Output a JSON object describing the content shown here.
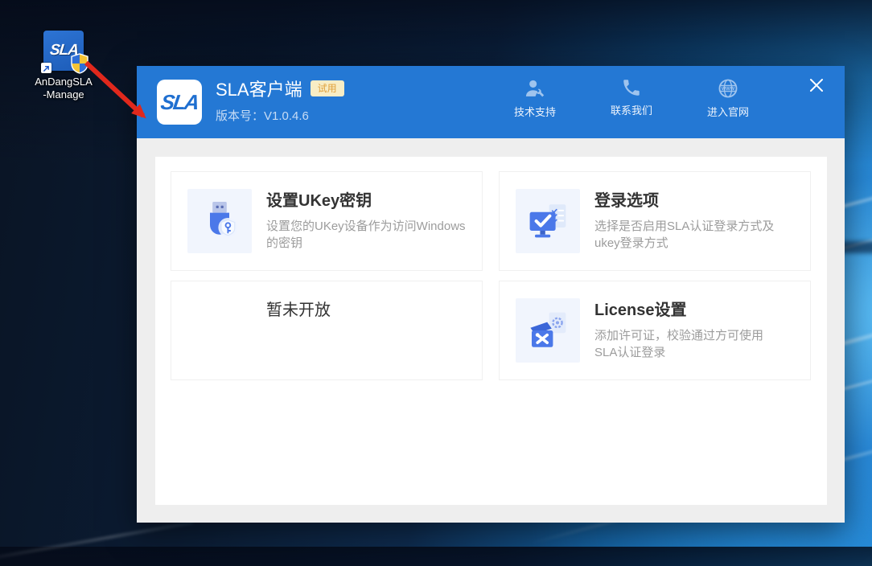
{
  "desktop_icon": {
    "tile_text": "SLA",
    "label_line1": "AnDangSLA",
    "label_line2": "-Manage"
  },
  "window": {
    "logo_text": "SLA",
    "title": "SLA客户端",
    "trial_badge": "试用",
    "version": "版本号：V1.0.4.6",
    "header_actions": [
      {
        "label": "技术支持",
        "icon": "support-icon"
      },
      {
        "label": "联系我们",
        "icon": "phone-icon"
      },
      {
        "label": "进入官网",
        "icon": "globe-icon"
      }
    ],
    "cards": [
      {
        "title": "设置UKey密钥",
        "description": "设置您的UKey设备作为访问Windows\n的密钥",
        "icon": "ukey-icon"
      },
      {
        "title": "登录选项",
        "description": "选择是否启用SLA认证登录方式及\nukey登录方式",
        "icon": "login-options-icon"
      },
      {
        "title": "暂未开放",
        "description": "",
        "icon": ""
      },
      {
        "title": "License设置",
        "description": "添加许可证，校验通过方可使用\nSLA认证登录",
        "icon": "license-icon"
      }
    ]
  },
  "colors": {
    "header_blue": "#2478d4",
    "accent_blue": "#4b78e9",
    "badge_bg": "#f8edc5",
    "badge_text": "#dfa13d",
    "annotation_red": "#e0281c",
    "wallpaper_bright_blue": "#2b95dc"
  }
}
